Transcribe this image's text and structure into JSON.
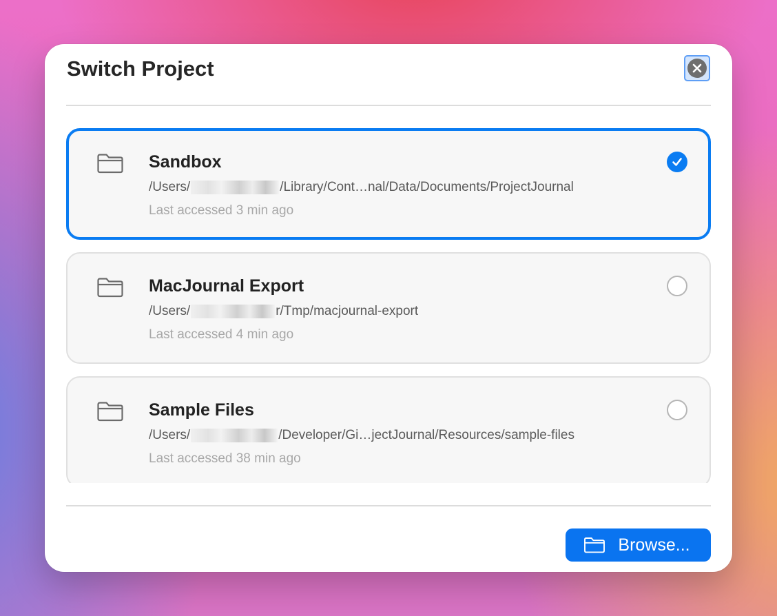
{
  "dialog": {
    "title": "Switch Project",
    "close_icon": "close-icon"
  },
  "projects": [
    {
      "name": "Sandbox",
      "path_prefix": "/Users/",
      "path_suffix": "/Library/Cont…nal/Data/Documents/ProjectJournal",
      "last_accessed": "Last accessed 3 min ago",
      "selected": true,
      "icon": "folder-icon"
    },
    {
      "name": "MacJournal Export",
      "path_prefix": "/Users/",
      "path_suffix": "r/Tmp/macjournal-export",
      "last_accessed": "Last accessed 4 min ago",
      "selected": false,
      "icon": "folder-icon"
    },
    {
      "name": "Sample Files",
      "path_prefix": "/Users/",
      "path_suffix": "/Developer/Gi…jectJournal/Resources/sample-files",
      "last_accessed": "Last accessed 38 min ago",
      "selected": false,
      "icon": "folder-icon"
    }
  ],
  "footer": {
    "browse_label": "Browse...",
    "browse_icon": "folder-icon"
  },
  "colors": {
    "accent": "#0a7cf2",
    "title_text": "#262626",
    "secondary_text": "#5a5a5a",
    "tertiary_text": "#a8a8a8",
    "card_background": "#f7f7f7",
    "card_border": "#e0e0e0"
  }
}
